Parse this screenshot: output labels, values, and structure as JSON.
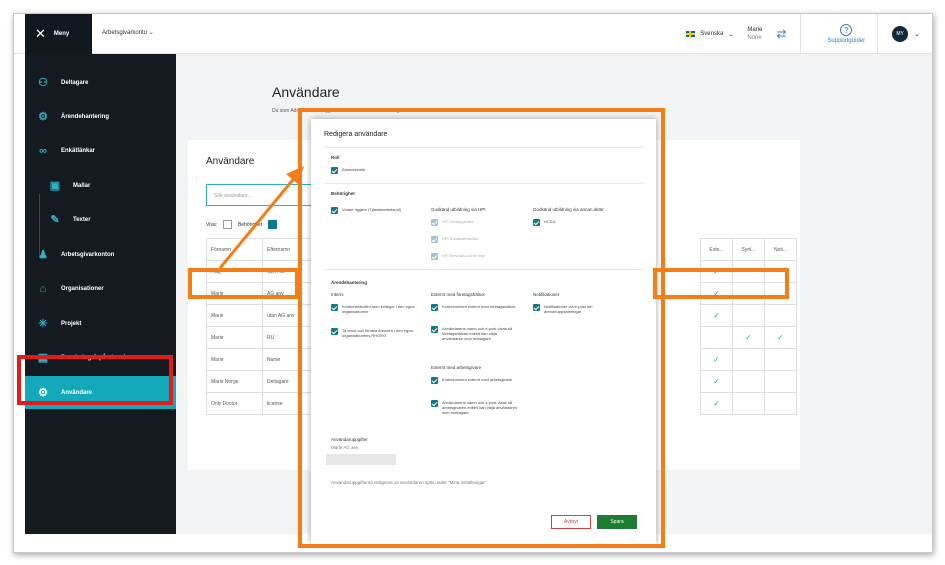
{
  "topbar": {
    "menu_label": "Meny",
    "org_label": "Arbetsgivarkonto",
    "language": "Svenska",
    "user_name": "Marie",
    "user_sub": "None",
    "support_label": "Supportguider",
    "avatar_initials": "MY"
  },
  "sidebar": {
    "items": [
      {
        "label": "Deltagare",
        "icon": "participants-icon"
      },
      {
        "label": "Ärendehantering",
        "icon": "case-icon"
      },
      {
        "label": "Enkätlänkar",
        "icon": "link-icon"
      },
      {
        "label": "Mallar",
        "icon": "template-icon"
      },
      {
        "label": "Texter",
        "icon": "edit-icon"
      },
      {
        "label": "Arbetsgivarkonton",
        "icon": "employer-icon"
      },
      {
        "label": "Organisationer",
        "icon": "org-icon"
      },
      {
        "label": "Projekt",
        "icon": "project-icon"
      },
      {
        "label": "Bevakning & påminnelser",
        "icon": "calendar-icon"
      },
      {
        "label": "Användare",
        "icon": "gear-icon"
      }
    ]
  },
  "page": {
    "title": "Användare",
    "description": "Du som Administratör lägger till fler användare samt redigerar accesser"
  },
  "users_card": {
    "title": "Användare",
    "search_placeholder": "Sök användare...",
    "show_label": "Visa:",
    "filter_label": "Behörighet",
    "columns": [
      "Förnamn",
      "Efternamn"
    ],
    "rows": [
      [
        "Flag",
        "CET, 09"
      ],
      [
        "Marie",
        "AG anv"
      ],
      [
        "Marie",
        "utan AG anv"
      ],
      [
        "Marie",
        "RU"
      ],
      [
        "Marie",
        "Nurse"
      ],
      [
        "Marie Norge",
        "Deltagare"
      ],
      [
        "Only Doctor",
        "license"
      ]
    ],
    "right_columns": [
      "Exte...",
      "Synl...",
      "Noti..."
    ],
    "right_rows": [
      [
        "✓",
        "",
        ""
      ],
      [
        "✓",
        "",
        ""
      ],
      [
        "✓",
        "",
        ""
      ],
      [
        "",
        "✓",
        "✓"
      ],
      [
        "✓",
        "",
        ""
      ],
      [
        "✓",
        "",
        ""
      ],
      [
        "✓",
        "",
        ""
      ]
    ]
  },
  "dialog": {
    "title": "Redigera användare",
    "role_heading": "Roll",
    "role_value": "Administratör",
    "auth_heading": "Behörighet",
    "auth_left": "Vidare tiggare (Tjänsteanhetsroll)",
    "auth_mid_heading": "Godkänd utbildning via HPI",
    "auth_mid": [
      "HPI Företagsvård",
      "HPI Kontinuitetsvård",
      "HPI Elevhälsa Grön linje"
    ],
    "auth_right_heading": "Godkänd utbildning via annan aktör",
    "auth_right": "HCSA",
    "case_heading": "Ärendehantering",
    "internal_heading": "Interni",
    "internal": [
      "Kontinuitetsvård med kollegor i den egna organisationen",
      "Ta emot och fördela ärenden i den egna organisationens RHORG"
    ],
    "ext_company_heading": "Externt med företagshälsor",
    "ext_company": [
      "Kommunicera externt med företagshälsor",
      "Användarens namn och e-post visas så företagshälsan enkelt kan välja användaren som mottagare"
    ],
    "ext_employer_heading": "Externt med arbetsgivare",
    "ext_employer": [
      "Kommunicera externt med arbetsgivare",
      "Användarens namn och e-post visas så arbetsgivaren enkelt kan välja användaren som mottagare"
    ],
    "notif_heading": "Notifikationer",
    "notif": "Notifikationer via e-post om ärendeuppdateringar",
    "details_heading": "Användaruppgifter",
    "details_name": "Marie AG anv",
    "details_note": "Användaruppgifterna redigeras av användaren själv under \"Mina inställningar\"",
    "cancel_label": "Avbryt",
    "save_label": "Spara"
  },
  "colors": {
    "sidebar_bg": "#141a1f",
    "active": "#13a9bb",
    "highlight_orange": "#f47d16",
    "highlight_red": "#e21b1b",
    "save_green": "#1e7b33"
  }
}
